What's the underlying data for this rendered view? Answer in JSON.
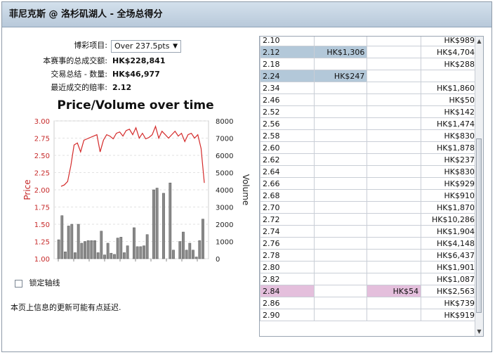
{
  "title": "菲尼克斯 @ 洛杉矶湖人 - 全场总得分",
  "info": {
    "bet_label": "博彩项目:",
    "bet_value": "Over 237.5pts",
    "total_label": "本赛事的总成交额:",
    "total_value": "HK$228,841",
    "volume_label": "交易总结 - 数量:",
    "volume_value": "HK$46,977",
    "odds_label": "最近成交的赔率:",
    "odds_value": "2.12"
  },
  "chart_data": {
    "type": "bar",
    "title": "Price/Volume over time",
    "ylabel": "Price",
    "y2label": "Volume",
    "ylim": [
      1.0,
      3.0
    ],
    "y2lim": [
      0,
      8000
    ],
    "yticks": [
      "3.00",
      "2.75",
      "2.50",
      "2.25",
      "2.00",
      "1.75",
      "1.50",
      "1.25",
      "1.00"
    ],
    "y2ticks": [
      "8000",
      "7000",
      "6000",
      "5000",
      "4000",
      "3000",
      "2000",
      "1000",
      "0"
    ],
    "price": [
      2.05,
      2.07,
      2.12,
      2.35,
      2.65,
      2.68,
      2.55,
      2.72,
      2.74,
      2.76,
      2.78,
      2.8,
      2.55,
      2.72,
      2.8,
      2.78,
      2.74,
      2.82,
      2.84,
      2.78,
      2.86,
      2.88,
      2.8,
      2.9,
      2.75,
      2.82,
      2.74,
      2.76,
      2.8,
      2.92,
      2.75,
      2.85,
      2.8,
      2.75,
      2.8,
      2.85,
      2.78,
      2.82,
      2.7,
      2.8,
      2.82,
      2.75,
      2.8,
      2.6,
      2.1
    ],
    "volume": [
      1100,
      2500,
      400,
      1900,
      2000,
      350,
      2000,
      900,
      1000,
      1050,
      1050,
      1050,
      350,
      1600,
      220,
      900,
      320,
      250,
      1200,
      1250,
      350,
      750,
      0,
      1800,
      700,
      700,
      750,
      1400,
      0,
      4000,
      4100,
      0,
      3800,
      0,
      4400,
      500,
      0,
      1000,
      1550,
      500,
      900,
      500,
      100,
      1050,
      2300
    ]
  },
  "checkbox_label": "锁定轴线",
  "note": "本页上信息的更新可能有点延迟.",
  "table": {
    "rows": [
      {
        "odds": "2.10",
        "back": "",
        "lay": "",
        "total": "HK$989",
        "hl": ""
      },
      {
        "odds": "2.12",
        "back": "HK$1,306",
        "lay": "",
        "total": "HK$4,704",
        "hl": "blue"
      },
      {
        "odds": "2.18",
        "back": "",
        "lay": "",
        "total": "HK$288",
        "hl": ""
      },
      {
        "odds": "2.24",
        "back": "HK$247",
        "lay": "",
        "total": "",
        "hl": "blue"
      },
      {
        "odds": "2.34",
        "back": "",
        "lay": "",
        "total": "HK$1,860",
        "hl": ""
      },
      {
        "odds": "2.46",
        "back": "",
        "lay": "",
        "total": "HK$50",
        "hl": ""
      },
      {
        "odds": "2.52",
        "back": "",
        "lay": "",
        "total": "HK$142",
        "hl": ""
      },
      {
        "odds": "2.56",
        "back": "",
        "lay": "",
        "total": "HK$1,474",
        "hl": ""
      },
      {
        "odds": "2.58",
        "back": "",
        "lay": "",
        "total": "HK$830",
        "hl": ""
      },
      {
        "odds": "2.60",
        "back": "",
        "lay": "",
        "total": "HK$1,878",
        "hl": ""
      },
      {
        "odds": "2.62",
        "back": "",
        "lay": "",
        "total": "HK$237",
        "hl": ""
      },
      {
        "odds": "2.64",
        "back": "",
        "lay": "",
        "total": "HK$830",
        "hl": ""
      },
      {
        "odds": "2.66",
        "back": "",
        "lay": "",
        "total": "HK$929",
        "hl": ""
      },
      {
        "odds": "2.68",
        "back": "",
        "lay": "",
        "total": "HK$910",
        "hl": ""
      },
      {
        "odds": "2.70",
        "back": "",
        "lay": "",
        "total": "HK$1,870",
        "hl": ""
      },
      {
        "odds": "2.72",
        "back": "",
        "lay": "",
        "total": "HK$10,286",
        "hl": ""
      },
      {
        "odds": "2.74",
        "back": "",
        "lay": "",
        "total": "HK$1,904",
        "hl": ""
      },
      {
        "odds": "2.76",
        "back": "",
        "lay": "",
        "total": "HK$4,148",
        "hl": ""
      },
      {
        "odds": "2.78",
        "back": "",
        "lay": "",
        "total": "HK$6,437",
        "hl": ""
      },
      {
        "odds": "2.80",
        "back": "",
        "lay": "",
        "total": "HK$1,901",
        "hl": ""
      },
      {
        "odds": "2.82",
        "back": "",
        "lay": "",
        "total": "HK$1,087",
        "hl": ""
      },
      {
        "odds": "2.84",
        "back": "",
        "lay": "HK$54",
        "total": "HK$2,563",
        "hl": "pink"
      },
      {
        "odds": "2.86",
        "back": "",
        "lay": "",
        "total": "HK$739",
        "hl": ""
      },
      {
        "odds": "2.90",
        "back": "",
        "lay": "",
        "total": "HK$919",
        "hl": ""
      }
    ]
  },
  "colors": {
    "price_line": "#d42a2a",
    "volume_bar": "#8a8a8a",
    "highlight_blue": "#b3c8d9",
    "highlight_pink": "#e4bfdc"
  }
}
